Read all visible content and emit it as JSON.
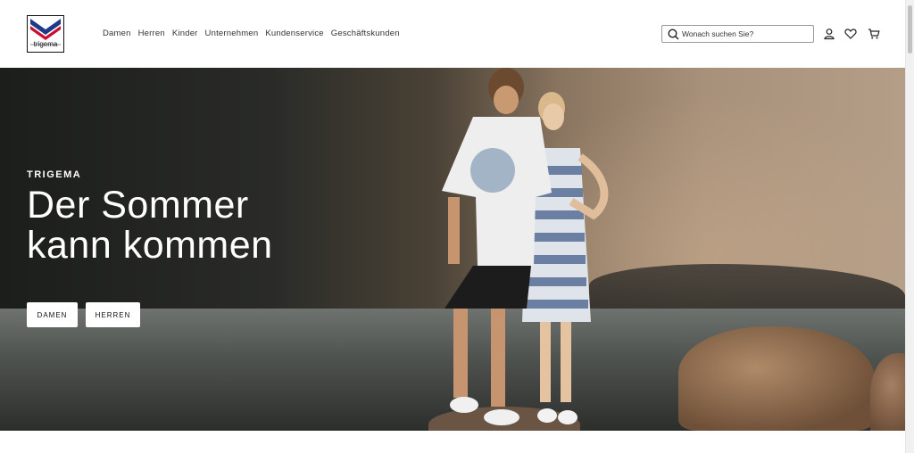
{
  "header": {
    "logo_text": "trigema",
    "nav": [
      "Damen",
      "Herren",
      "Kinder",
      "Unternehmen",
      "Kundenservice",
      "Geschäftskunden"
    ],
    "search": {
      "placeholder": "Wonach suchen Sie?"
    },
    "icons": [
      "search-icon",
      "account-icon",
      "wishlist-heart-icon",
      "cart-icon"
    ]
  },
  "hero": {
    "brand": "TRIGEMA",
    "headline_line1": "Der Sommer",
    "headline_line2": "kann kommen",
    "buttons": [
      "DAMEN",
      "HERREN"
    ]
  },
  "colors": {
    "text": "#333333",
    "hero_text": "#ffffff",
    "logo_blue": "#1f3a8a",
    "logo_red": "#c8102e"
  }
}
